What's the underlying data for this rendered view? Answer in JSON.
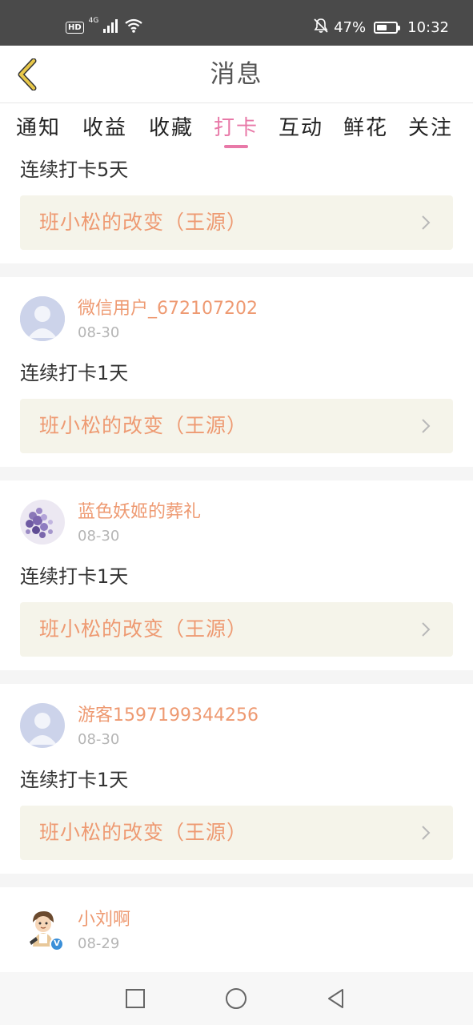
{
  "status_bar": {
    "hd_badge": "HD",
    "signal_label": "4G",
    "battery_percent": "47%",
    "time": "10:32"
  },
  "header": {
    "title": "消息",
    "back_icon": "back-chevron-icon",
    "accent_color": "#e8c84a"
  },
  "tabs": [
    {
      "label": "通知",
      "active": false
    },
    {
      "label": "收益",
      "active": false
    },
    {
      "label": "收藏",
      "active": false
    },
    {
      "label": "打卡",
      "active": true
    },
    {
      "label": "互动",
      "active": false
    },
    {
      "label": "鲜花",
      "active": false
    },
    {
      "label": "关注",
      "active": false
    }
  ],
  "colors": {
    "active_tab": "#e879a8",
    "user_name": "#ee9a72",
    "book_title": "#ee9a72",
    "card_background": "#f5f4ea",
    "separator": "#f5f5f5"
  },
  "feed": {
    "partial_top": {
      "checkin_text": "连续打卡5天",
      "book_title": "班小松的改变（王源）"
    },
    "items": [
      {
        "user_name": "微信用户_672107202",
        "date": "08-30",
        "checkin_text": "连续打卡1天",
        "book_title": "班小松的改变（王源）",
        "avatar": "default-avatar-icon"
      },
      {
        "user_name": "蓝色妖姬的葬礼",
        "date": "08-30",
        "checkin_text": "连续打卡1天",
        "book_title": "班小松的改变（王源）",
        "avatar": "lavender-flower-avatar"
      },
      {
        "user_name": "游客1597199344256",
        "date": "08-30",
        "checkin_text": "连续打卡1天",
        "book_title": "班小松的改变（王源）",
        "avatar": "default-avatar-icon"
      },
      {
        "user_name": "小刘啊",
        "date": "08-29",
        "avatar": "cartoon-boy-avatar",
        "verified": "V"
      }
    ]
  },
  "nav_bar": {
    "recents_icon": "square-recents-icon",
    "home_icon": "circle-home-icon",
    "back_icon": "triangle-back-icon"
  }
}
